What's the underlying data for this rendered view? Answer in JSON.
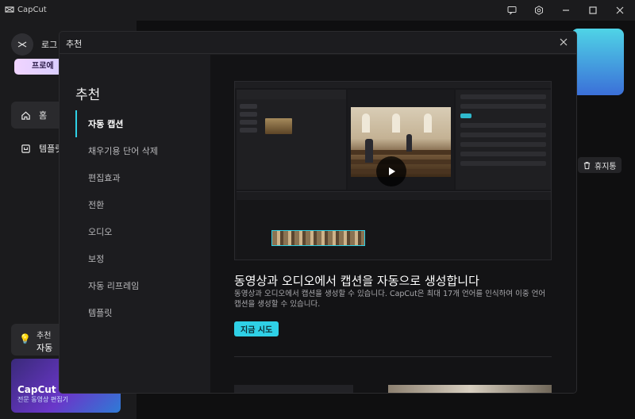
{
  "app": {
    "name": "CapCut"
  },
  "sidebar": {
    "login_label": "로그",
    "pro_label": "프로에",
    "nav": [
      {
        "label": "홈"
      },
      {
        "label": "템플릿"
      }
    ],
    "promo_top": "추천",
    "promo_bottom": "자동",
    "ad_brand": "CapCut",
    "ad_sub": "전문 동영상 편집기"
  },
  "main": {
    "trash_label": "휴지통"
  },
  "modal": {
    "title": "추천",
    "heading": "추천",
    "categories": [
      {
        "label": "자동 캡션"
      },
      {
        "label": "채우기용 단어 삭제"
      },
      {
        "label": "편집효과"
      },
      {
        "label": "전환"
      },
      {
        "label": "오디오"
      },
      {
        "label": "보정"
      },
      {
        "label": "자동 리프레임"
      },
      {
        "label": "템플릿"
      }
    ],
    "active_index": 0,
    "feature": {
      "title": "동영상과 오디오에서 캡션을 자동으로 생성합니다",
      "description": "동영상과 오디오에서 캡션을 생성할 수 있습니다. CapCut은 최대 17개 언어를 인식하여 이중 언어 캡션을 생성할 수 있습니다.",
      "button": "지금 시도"
    }
  },
  "colors": {
    "accent": "#2fd0e6",
    "bg": "#0f0f10",
    "panel": "#1c1c1f"
  },
  "icons": [
    "capcut-logo-icon",
    "feedback-icon",
    "settings-icon",
    "minimize-icon",
    "maximize-icon",
    "close-icon",
    "home-icon",
    "template-icon",
    "bulb-icon",
    "trash-icon",
    "play-icon"
  ]
}
